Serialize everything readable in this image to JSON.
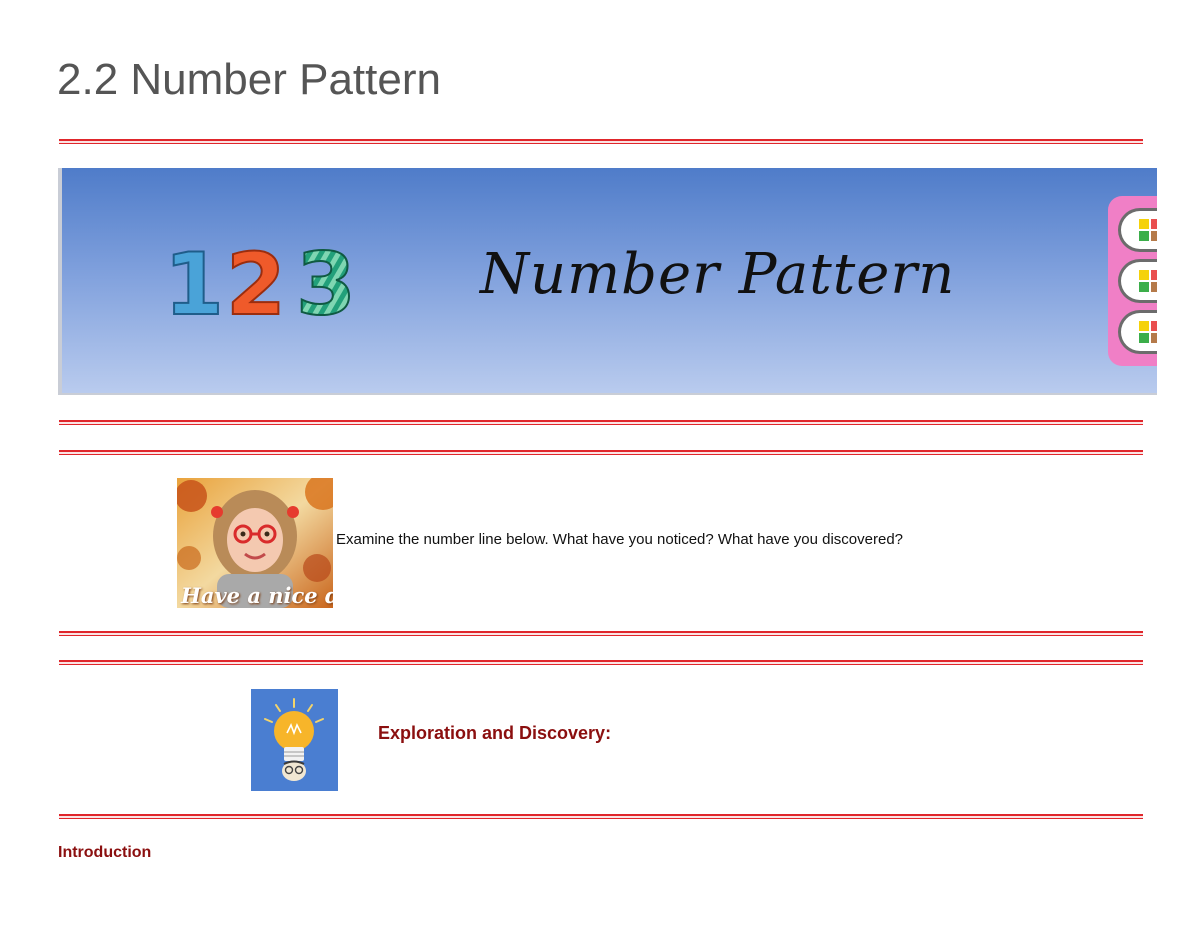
{
  "document": {
    "title": "2.2 Number Pattern"
  },
  "banner": {
    "digits": [
      "1",
      "2",
      "3"
    ],
    "title": "Number Pattern",
    "colors": {
      "digit_1": "#4aa3d8",
      "digit_2": "#ef5a2a",
      "digit_3": "#22a07a",
      "gradient_top": "#4f7cc9",
      "side_panel": "#f07fc6"
    }
  },
  "intro_block": {
    "avatar_caption": "Have a nice day!",
    "prompt": "Examine the number line below. What have you noticed? What have you discovered?"
  },
  "exploration": {
    "icon": "lightbulb-icon",
    "heading": "Exploration and Discovery:"
  },
  "introduction": {
    "heading": "Introduction"
  },
  "colors": {
    "rule": "#e0262b",
    "heading": "#8b0f0f",
    "title_text": "#555555"
  }
}
